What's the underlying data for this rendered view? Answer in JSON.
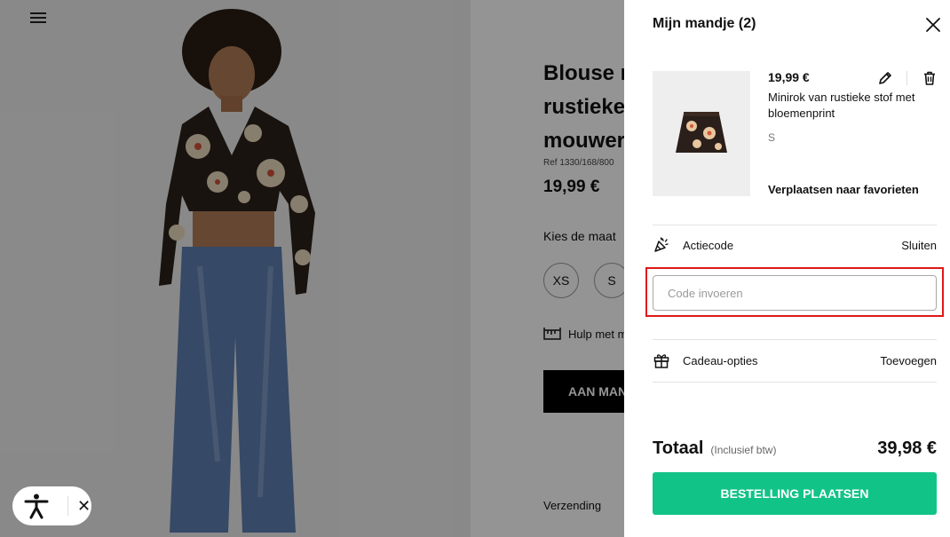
{
  "product": {
    "title_lines": [
      "Blouse m",
      "rustieke",
      "mouwer"
    ],
    "ref": "Ref 1330/168/800",
    "price": "19,99 €",
    "size_label": "Kies de maat",
    "sizes": [
      "XS",
      "S"
    ],
    "help_text": "Hulp met m",
    "add_button": "AAN MAN",
    "shipping": "Verzending"
  },
  "cart": {
    "title": "Mijn mandje (2)",
    "item": {
      "price": "19,99 €",
      "name": "Minirok van rustieke stof met bloemenprint",
      "size": "S",
      "move_to_favorites": "Verplaatsen naar favorieten"
    },
    "promo": {
      "label": "Actiecode",
      "action": "Sluiten",
      "placeholder": "Code invoeren"
    },
    "gift": {
      "label": "Cadeau-opties",
      "action": "Toevoegen"
    },
    "total": {
      "label": "Totaal",
      "note": "(Inclusief btw)",
      "value": "39,98 €"
    },
    "checkout_button": "BESTELLING PLAATSEN"
  },
  "accessibility": {
    "icon": "accessibility-person-icon",
    "close_icon": "close-icon"
  },
  "colors": {
    "checkout": "#12c387",
    "highlight": "#e01818",
    "add_button": "#000000"
  }
}
